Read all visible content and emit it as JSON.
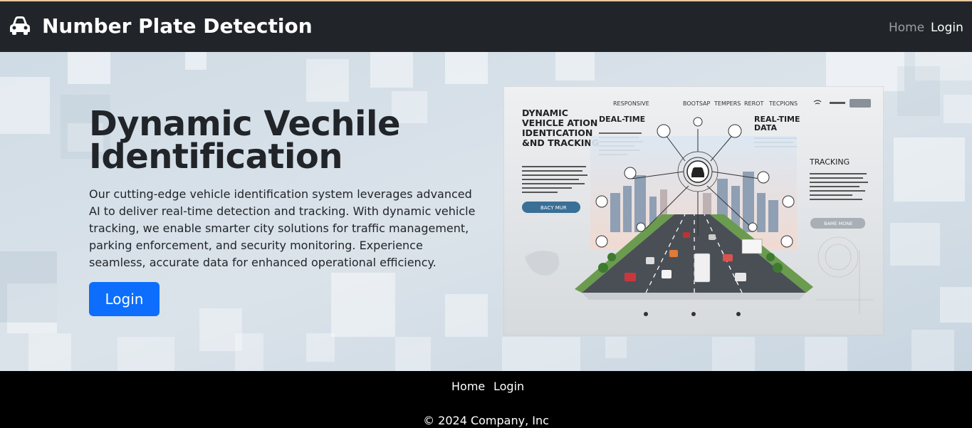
{
  "navbar": {
    "brand": "Number Plate Detection",
    "brand_icon": "car-icon",
    "links": [
      "Home",
      "Login"
    ]
  },
  "hero": {
    "title": "Dynamic Vechile Identification",
    "description": "Our cutting-edge vehicle identification system leverages advanced AI to deliver real-time detection and tracking. With dynamic vehicle tracking, we enable smarter city solutions for traffic management, parking enforcement, and security monitoring. Experience seamless, accurate data for enhanced operational efficiency.",
    "button": "Login",
    "image": {
      "nav_items": [
        "RESPONSIVE",
        "BOOTSAP",
        "TEMPERS",
        "REROT",
        "TECPIONS"
      ],
      "heading": "DYNAMIC VEHICLE ATION IDENTICATION &ND TRACKING",
      "label_left": "DEAL-TIME",
      "label_right": "REAL-TIME DATA",
      "label_tracking": "TRACKING",
      "btn_left": "BACY MUR",
      "btn_right": "BAME MONE"
    }
  },
  "footer": {
    "links": [
      "Home",
      "Login"
    ],
    "copyright": "© 2024 Company, Inc"
  },
  "colors": {
    "navbar_bg": "#212529",
    "primary": "#0d6efd",
    "footer_bg": "#000000",
    "hero_bg": "#d3dde6"
  }
}
